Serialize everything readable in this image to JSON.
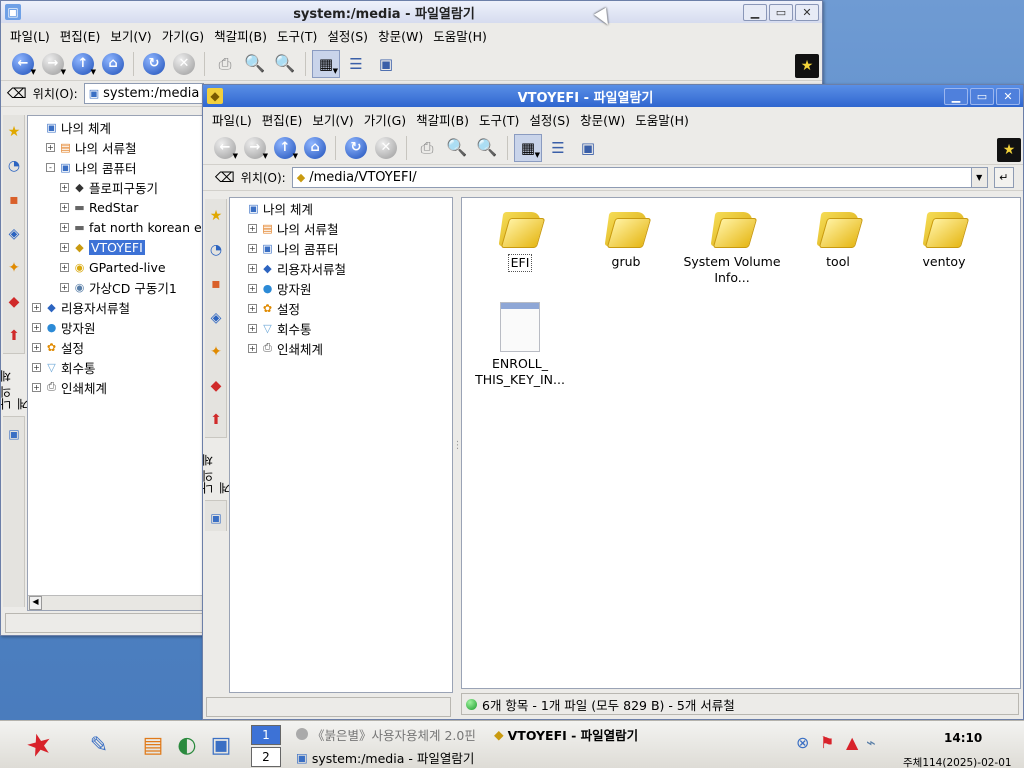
{
  "window_back": {
    "title": "system:/media - 파일열람기",
    "location_label": "위치(O):",
    "location_value": "system:/media",
    "tree": [
      {
        "label": "나의 체계",
        "level": 0,
        "expander": "",
        "icon": "monitor-icon"
      },
      {
        "label": "나의 서류철",
        "level": 1,
        "expander": "+",
        "icon": "documents-icon"
      },
      {
        "label": "나의 콤퓨터",
        "level": 1,
        "expander": "-",
        "icon": "computer-icon"
      },
      {
        "label": "플로피구동기",
        "level": 2,
        "expander": "+",
        "icon": "floppy-icon"
      },
      {
        "label": "RedStar",
        "level": 2,
        "expander": "+",
        "icon": "harddisk-icon"
      },
      {
        "label": "fat north korean egg",
        "level": 2,
        "expander": "+",
        "icon": "harddisk-icon"
      },
      {
        "label": "VTOYEFI",
        "level": 2,
        "expander": "+",
        "icon": "usb-drive-icon",
        "selected": true
      },
      {
        "label": "GParted-live",
        "level": 2,
        "expander": "+",
        "icon": "cdrom-icon"
      },
      {
        "label": "가상CD 구동기1",
        "level": 2,
        "expander": "+",
        "icon": "virtual-cd-icon"
      },
      {
        "label": "리용자서류철",
        "level": 0,
        "expander": "+",
        "icon": "user-folder-icon"
      },
      {
        "label": "망자원",
        "level": 0,
        "expander": "+",
        "icon": "globe-icon"
      },
      {
        "label": "설정",
        "level": 0,
        "expander": "+",
        "icon": "settings-icon"
      },
      {
        "label": "회수통",
        "level": 0,
        "expander": "+",
        "icon": "trash-icon"
      },
      {
        "label": "인쇄체계",
        "level": 0,
        "expander": "+",
        "icon": "printer-icon"
      }
    ],
    "sidebar_tab_label": "나의 체계"
  },
  "window_front": {
    "title": "VTOYEFI - 파일열람기",
    "location_label": "위치(O):",
    "location_value": "/media/VTOYEFI/",
    "tree": [
      {
        "label": "나의 체계",
        "level": 0,
        "expander": "",
        "icon": "monitor-icon"
      },
      {
        "label": "나의 서류철",
        "level": 1,
        "expander": "+",
        "icon": "documents-icon"
      },
      {
        "label": "나의 콤퓨터",
        "level": 1,
        "expander": "+",
        "icon": "computer-icon"
      },
      {
        "label": "리용자서류철",
        "level": 1,
        "expander": "+",
        "icon": "user-folder-icon"
      },
      {
        "label": "망자원",
        "level": 1,
        "expander": "+",
        "icon": "globe-icon"
      },
      {
        "label": "설정",
        "level": 1,
        "expander": "+",
        "icon": "settings-icon"
      },
      {
        "label": "회수통",
        "level": 1,
        "expander": "+",
        "icon": "trash-icon"
      },
      {
        "label": "인쇄체계",
        "level": 1,
        "expander": "+",
        "icon": "printer-icon"
      }
    ],
    "files": [
      {
        "name": "EFI",
        "type": "folder"
      },
      {
        "name": "grub",
        "type": "folder"
      },
      {
        "name": "System Volume Info...",
        "type": "folder"
      },
      {
        "name": "tool",
        "type": "folder"
      },
      {
        "name": "ventoy",
        "type": "folder"
      },
      {
        "name": "ENROLL_ THIS_KEY_IN...",
        "type": "file"
      }
    ],
    "status": "6개 항목 - 1개 파일 (모두 829 B) - 5개 서류철",
    "sidebar_tab_label": "나의 체계"
  },
  "menu": [
    "파일(L)",
    "편집(E)",
    "보기(V)",
    "가기(G)",
    "책갈피(B)",
    "도구(T)",
    "설정(S)",
    "창문(W)",
    "도움말(H)"
  ],
  "taskbar": {
    "desktop_pages": [
      "1",
      "2"
    ],
    "tasks": [
      {
        "label": "《붉은별》사용자용체계 2.0핀",
        "icon": "redstar-disc-icon"
      },
      {
        "label": "VTOYEFI - 파일열람기",
        "icon": "usb-drive-icon",
        "active": true
      },
      {
        "label": "system:/media - 파일열람기",
        "icon": "file-manager-icon"
      }
    ],
    "clock": "14:10",
    "date": "주체114(2025)-02-01"
  },
  "colors": {
    "selection": "#3d72d6",
    "active_title": "#2f66cf",
    "desktop": "#4f83c5"
  }
}
